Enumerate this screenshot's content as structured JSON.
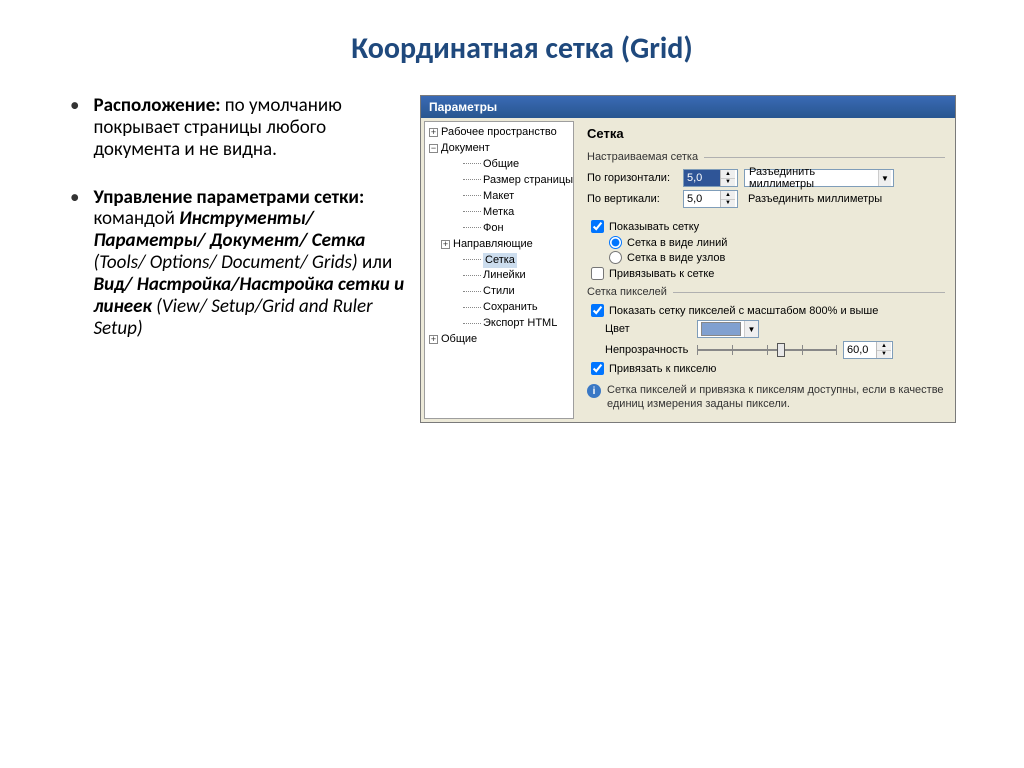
{
  "title": "Координатная сетка (Grid)",
  "bullets": {
    "b1_label": "Расположение:",
    "b1_text": " по умолчанию покрывает страницы любого документа и не видна.",
    "b2_label": "Управление параметрами сетки:",
    "b2_cmd": " командой ",
    "b2_path_ru": "Инструменты/ Параметры/ Документ/ Сетка",
    "b2_path_en": " (Tools/ Options/ Document/ Grids) ",
    "b2_or": "или ",
    "b2_view_ru": "Вид/ Настройка/",
    "b2_view_ru2": "Настройка сетки и линеек",
    "b2_view_en": " (View/ Setup/Grid and Ruler Setup)"
  },
  "dialog": {
    "title": "Параметры",
    "tree": {
      "n0": "Рабочее пространство",
      "n1": "Документ",
      "n1_0": "Общие",
      "n1_1": "Размер страницы",
      "n1_2": "Макет",
      "n1_3": "Метка",
      "n1_4": "Фон",
      "n1_5": "Направляющие",
      "n1_6": "Сетка",
      "n1_7": "Линейки",
      "n1_8": "Стили",
      "n1_9": "Сохранить",
      "n1_10": "Экспорт HTML",
      "n2": "Общие"
    },
    "panel_title": "Сетка",
    "grp_custom": "Настраиваемая сетка",
    "row_h_label": "По горизонтали:",
    "row_h_value": "5,0",
    "row_h_combo": "Разъединить миллиметры",
    "row_v_label": "По вертикали:",
    "row_v_value": "5,0",
    "row_v_combo": "Разъединить миллиметры",
    "chk_show": "Показывать сетку",
    "radio_lines": "Сетка в виде линий",
    "radio_nodes": "Сетка в виде узлов",
    "chk_snap": "Привязывать к сетке",
    "grp_pixel": "Сетка пикселей",
    "chk_pixel_show": "Показать сетку пикселей с масштабом 800% и выше",
    "lbl_color": "Цвет",
    "lbl_opacity": "Непрозрачность",
    "opacity_value": "60,0",
    "chk_pixel_snap": "Привязать к пикселю",
    "info_text": "Сетка пикселей и привязка к пикселям доступны, если в качестве единиц измерения заданы пиксели."
  }
}
